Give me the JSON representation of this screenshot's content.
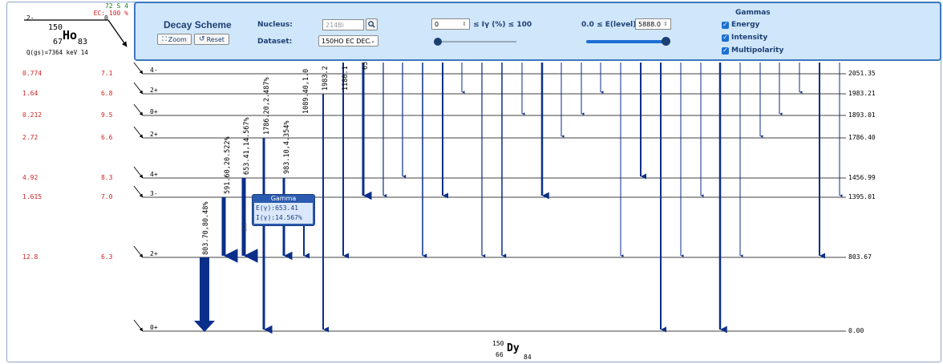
{
  "parent": {
    "spin_parity": "2-",
    "half_life": "72 S 4",
    "ec_branch": "EC: 100 %",
    "level": "0",
    "mass": "150",
    "symbol": "Ho",
    "z": "67",
    "n": "83",
    "qvalue": "Q(gs)=7364 keV 14"
  },
  "panel": {
    "title": "Decay Scheme",
    "zoom_label": "Zoom",
    "reset_label": "Reset",
    "nucleus_label": "Nucleus:",
    "nucleus_placeholder": "214Bi",
    "dataset_label": "Dataset:",
    "dataset_value": "150HO EC DECA",
    "intensity_min_value": "0",
    "intensity_label": "≤ Iγ (%) ≤ 100",
    "intensity_slider_value": 0,
    "energy_label": "0.0 ≤ E(level) ≤",
    "energy_max_value": "5888.0",
    "energy_slider_value": 1,
    "gammas_title": "Gammas",
    "checkboxes": [
      "Energy",
      "Intensity",
      "Multipolarity"
    ]
  },
  "levels": [
    {
      "energy": "2051.35",
      "spin": "4-",
      "ib": "0.774",
      "logft": "7.1"
    },
    {
      "energy": "1983.21",
      "spin": "2+",
      "ib": "1.64",
      "logft": "6.8"
    },
    {
      "energy": "1893.01",
      "spin": "0+",
      "ib": "0.212",
      "logft": "9.5"
    },
    {
      "energy": "1786.40",
      "spin": "2+",
      "ib": "2.72",
      "logft": "6.6"
    },
    {
      "energy": "1456.99",
      "spin": "4+",
      "ib": "4.92",
      "logft": "8.3"
    },
    {
      "energy": "1395.01",
      "spin": "3-",
      "ib": "1.615",
      "logft": "7.0"
    },
    {
      "energy": "803.67",
      "spin": "2+",
      "ib": "12.8",
      "logft": "6.3"
    },
    {
      "energy": "0.00",
      "spin": "0+",
      "ib": "",
      "logft": ""
    }
  ],
  "gamma_labels": [
    "803.70,80.48%",
    "591.60,20.522%",
    "653.41,14.567%",
    "1786.20,2.487%",
    "983.10,4.354%",
    "1089.40,1.0",
    "1983.2",
    "1180.1",
    "65"
  ],
  "tooltip": {
    "title": "Gamma",
    "energy": "E(γ):653.41",
    "intensity": "I(γ):14.567%"
  },
  "daughter": {
    "mass": "150",
    "symbol": "Dy",
    "z": "66",
    "n": "84"
  },
  "colors": {
    "gamma": "#0b2e8a",
    "panel_bg": "#cfe6fb",
    "accent": "#1d6fd1",
    "red_text": "#d02020"
  }
}
